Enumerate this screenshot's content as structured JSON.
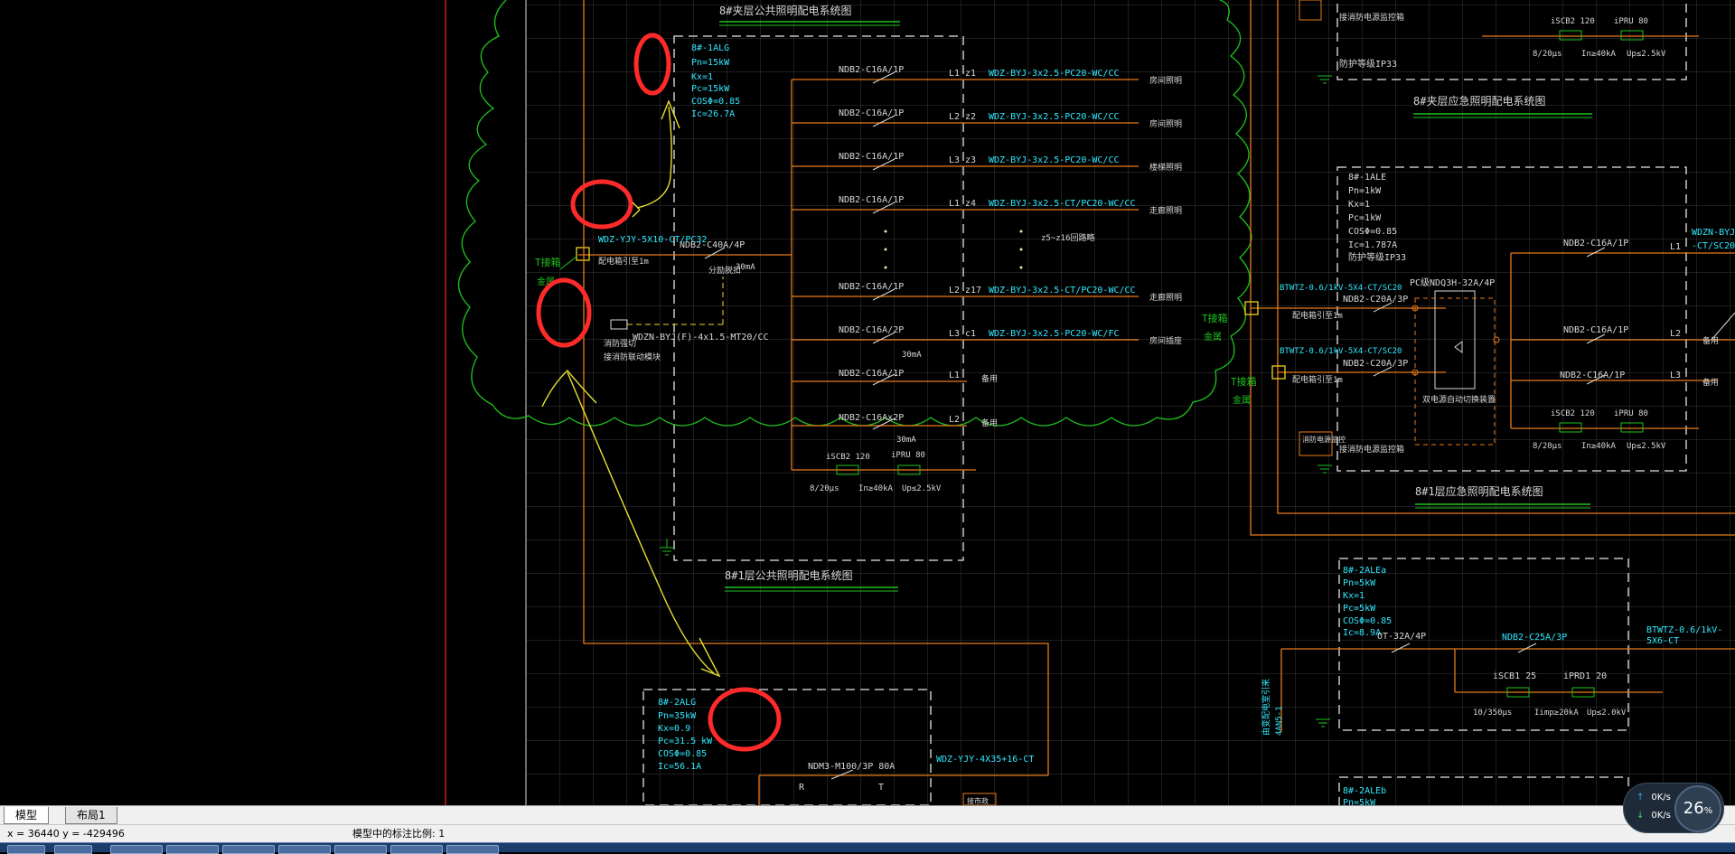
{
  "drawing": {
    "titles": {
      "b8_mezz_public": "8#夹层公共照明配电系统图",
      "b8_floor1_public": "8#1层公共照明配电系统图",
      "b8_mezz_emergency": "8#夹层应急照明配电系统图",
      "b8_floor1_emergency": "8#1层应急照明配电系统图"
    },
    "panel_1alg": {
      "params": [
        "8#-1ALG",
        "Pn=15kW",
        "Kx=1",
        "Pc=15kW",
        "COSΦ=0.85",
        "Ic=26.7A"
      ],
      "circuits": [
        {
          "breaker": "NDB2-C16A/1P",
          "phase": "L1",
          "no": "z1",
          "cable": "WDZ-BYJ-3x2.5-PC20-WC/CC",
          "load": "房间照明"
        },
        {
          "breaker": "NDB2-C16A/1P",
          "phase": "L2",
          "no": "z2",
          "cable": "WDZ-BYJ-3x2.5-PC20-WC/CC",
          "load": "房间照明"
        },
        {
          "breaker": "NDB2-C16A/1P",
          "phase": "L3",
          "no": "z3",
          "cable": "WDZ-BYJ-3x2.5-PC20-WC/CC",
          "load": "楼梯照明"
        },
        {
          "breaker": "NDB2-C16A/1P",
          "phase": "L1",
          "no": "z4",
          "cable": "WDZ-BYJ-3x2.5-CT/PC20-WC/CC",
          "load": "走廊照明"
        },
        {
          "breaker": "NDB2-C16A/1P",
          "phase": "L2",
          "no": "z17",
          "cable": "WDZ-BYJ-3x2.5-CT/PC20-WC/CC",
          "load": "走廊照明"
        },
        {
          "breaker": "NDB2-C16A/2P",
          "phase": "L3",
          "no": "c1",
          "cable": "WDZ-BYJ-3x2.5-PC20-WC/FC",
          "load": "房间插座"
        },
        {
          "breaker": "NDB2-C16A/1P",
          "phase": "L1",
          "no": "",
          "cable": "",
          "load": "备用"
        },
        {
          "breaker": "NDB2-C16Ax2P",
          "phase": "L2",
          "no": "",
          "cable": "",
          "load": "备用"
        }
      ],
      "omitted_note": "z5~z16回路略",
      "rcd_30ma": "30mA",
      "main_breaker": "NDB2-C40A/4P",
      "shunt_label": "分励脱扣",
      "incoming_cable": "WDZ-YJY-5X10-CT/PC32",
      "incoming_note": "配电箱引至1m",
      "t_tap": "T接箱",
      "t_tap2": "金属",
      "fire_cable": "WDZN-BYJ(F)-4x1.5-MT20/CC",
      "fire_label": "消防强切",
      "fire_label2": "接消防联动模块",
      "spd": "iSCB2 120",
      "spd2": "iPRU 80",
      "spd_spec1": "8/20μs",
      "spd_spec2": "In≥40kA",
      "spd_spec3": "Up≤2.5kV"
    },
    "panel_2alg": {
      "params": [
        "8#-2ALG",
        "Pn=35kW",
        "Kx=0.9",
        "Pc=31.5 kW",
        "COSΦ=0.85",
        "Ic=56.1A"
      ],
      "breaker": "NDM3-M100/3P 80A",
      "cable": "WDZ-YJY-4X35+16-CT",
      "r": "R",
      "t": "T",
      "note": "接市政"
    },
    "panel_1ale": {
      "params": [
        "8#-1ALE",
        "Pn=1kW",
        "Kx=1",
        "Pc=1kW",
        "COSΦ=0.85",
        "Ic=1.787A"
      ],
      "protection": "防护等级IP33",
      "breaker1": "NDB2-C20A/3P",
      "breaker2": "NDB2-C20A/3P",
      "ats": "PC级NDQ3H-32A/4P",
      "ats_label": "双电源自动切换装置",
      "cable1": "BTWTZ-0.6/1kV-5X4-CT/SC20",
      "cable2": "BTWTZ-0.6/1kV-5X4-CT/SC20",
      "cable_note": "配电箱引至1m",
      "out1_breaker": "NDB2-C16A/1P",
      "out1_phase": "L1",
      "out1_cable": "WDZN-BYJ",
      "out1_cable2": "-CT/SC20",
      "out2_breaker": "NDB2-C16A/1P",
      "out2_phase": "L2",
      "out2_load": "备用",
      "out3_breaker": "NDB2-C16A/1P",
      "out3_phase": "L3",
      "out3_load": "备用",
      "spd": "iSCB2 120",
      "spd2": "iPRU 80",
      "spd_spec1": "8/20μs",
      "spd_spec2": "In≥40kA",
      "spd_spec3": "Up≤2.5kV",
      "fire_box": "消防电源监控",
      "fire_box2": "接消防电源监控箱",
      "t_tap": "T接箱",
      "t_tap2": "金属"
    },
    "panel_top": {
      "protection": "防护等级IP33",
      "spd": "iSCB2 120",
      "spd2": "iPRU 80",
      "spd_spec1": "8/20μs",
      "spd_spec2": "In≥40kA",
      "spd_spec3": "Up≤2.5kV",
      "fire_box": "接消防电源监控箱"
    },
    "panel_2ale": {
      "params": [
        "8#-2ALEa",
        "Pn=5kW",
        "Kx=1",
        "Pc=5kW",
        "COSΦ=0.85",
        "Ic=8.9A"
      ],
      "breaker": "OT-32A/4P",
      "breaker2": "NDB2-C25A/3P",
      "spd": "iSCB1 25",
      "spd2": "iPRD1 20",
      "spd_spec1": "10/350μs",
      "spd_spec2": "Iimp≥20kA",
      "spd_spec3": "Up≤2.0kV",
      "cable": "BTWTZ-0.6/1kV-",
      "cable2": "5X6-CT",
      "incoming": "由变配电室引来",
      "incoming2": "4AN5-1",
      "panel_b": "8#-2ALEb",
      "panel_b_pn": "Pn=5kW"
    }
  },
  "layout_tabs": [
    "模型",
    "布局1"
  ],
  "status": {
    "coords": "x = 36440  y = -429496",
    "annotation_scale": "模型中的标注比例: 1"
  },
  "net_widget": {
    "upload": "0K/s",
    "download": "0K/s",
    "percent": "26",
    "percent_unit": "%"
  }
}
